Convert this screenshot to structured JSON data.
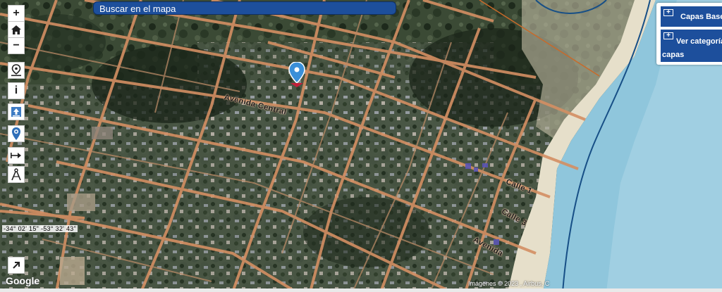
{
  "search": {
    "placeholder": "Buscar en el mapa"
  },
  "toolbar": {
    "zoom_in": "+",
    "zoom_out": "−",
    "info": "i"
  },
  "layers_panel": {
    "base_layers_label": "Capas Base",
    "categories_label_line1": "Ver categorías d",
    "categories_label_line2": "capas"
  },
  "coordinates": {
    "text": "-34° 02' 15\"  -53° 32' 43\""
  },
  "attribution": {
    "text": "Imágenes © 2023 , Airbus, C"
  },
  "google_logo": {
    "text": "Google"
  },
  "streets": {
    "avenida_central": "Avenida Central",
    "calle_1": "Calle 1",
    "calle_3": "Calle 3",
    "avenida": "Avenida"
  },
  "colors": {
    "accent_blue": "#1d4f9c",
    "ocean": "#8fc6dc",
    "sand": "#e6dfca",
    "street": "#d48f63",
    "marker": "#3a8fd8"
  }
}
